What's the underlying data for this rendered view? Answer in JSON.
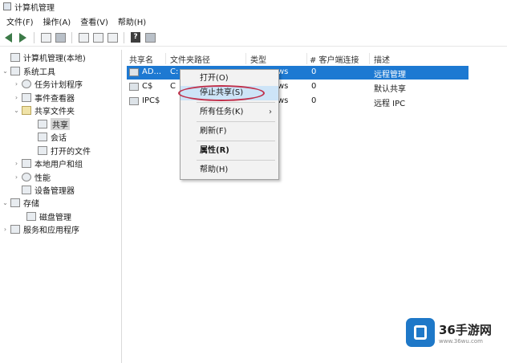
{
  "window": {
    "title": "计算机管理"
  },
  "menu": [
    "文件(F)",
    "操作(A)",
    "查看(V)",
    "帮助(H)"
  ],
  "toolbar": {
    "help_label": "?"
  },
  "tree": [
    {
      "label": "计算机管理(本地)",
      "icon": "computer-icon",
      "chevron": ""
    },
    {
      "label": "系统工具",
      "icon": "tools-icon",
      "chevron": "⌄"
    },
    {
      "label": "任务计划程序",
      "icon": "clock-icon",
      "chevron": "›"
    },
    {
      "label": "事件查看器",
      "icon": "event-icon",
      "chevron": "›"
    },
    {
      "label": "共享文件夹",
      "icon": "folder-icon",
      "chevron": "⌄"
    },
    {
      "label": "共享",
      "icon": "share-icon",
      "chevron": ""
    },
    {
      "label": "会话",
      "icon": "session-icon",
      "chevron": ""
    },
    {
      "label": "打开的文件",
      "icon": "file-icon",
      "chevron": ""
    },
    {
      "label": "本地用户和组",
      "icon": "users-icon",
      "chevron": "›"
    },
    {
      "label": "性能",
      "icon": "performance-icon",
      "chevron": "›"
    },
    {
      "label": "设备管理器",
      "icon": "device-icon",
      "chevron": ""
    },
    {
      "label": "存储",
      "icon": "storage-icon",
      "chevron": "⌄"
    },
    {
      "label": "磁盘管理",
      "icon": "disk-icon",
      "chevron": ""
    },
    {
      "label": "服务和应用程序",
      "icon": "services-icon",
      "chevron": "›"
    }
  ],
  "list": {
    "columns": [
      "共享名",
      "文件夹路径",
      "类型",
      "# 客户端连接",
      "描述"
    ],
    "rows": [
      {
        "name": "AD...",
        "path": "C:",
        "type": "ws",
        "clients": "0",
        "desc": "远程管理"
      },
      {
        "name": "C$",
        "path": "C",
        "type": "ws",
        "clients": "0",
        "desc": "默认共享"
      },
      {
        "name": "IPC$",
        "path": "",
        "type": "ws",
        "clients": "0",
        "desc": "远程 IPC"
      }
    ]
  },
  "context_menu": {
    "items": [
      {
        "label": "打开(O)"
      },
      {
        "label": "停止共享(S)"
      },
      {
        "label": "所有任务(K)",
        "submenu": "›"
      },
      {
        "label": "刷新(F)"
      },
      {
        "label": "属性(R)"
      },
      {
        "label": "帮助(H)"
      }
    ]
  },
  "watermark": {
    "title": "36手游网",
    "url": "www.36wu.com"
  },
  "colors": {
    "selection": "#1d79d2",
    "highlight_ring": "#c0304b",
    "menu_hover": "#cde4f7"
  }
}
